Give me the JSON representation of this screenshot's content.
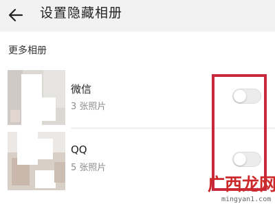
{
  "header": {
    "back_icon": "arrow-left-icon",
    "title": "设置隐藏相册"
  },
  "section": {
    "title": "更多相册"
  },
  "albums": [
    {
      "name": "微信",
      "count": "3 张照片",
      "hidden": false
    },
    {
      "name": "QQ",
      "count": "5 张照片",
      "hidden": false
    }
  ],
  "colors": {
    "header_bg": "#f2f2f2",
    "switch_off": "#ececec",
    "highlight": "#c8283c",
    "watermark": "#cc2a2a"
  },
  "watermark": {
    "logo_text": "广西龙网",
    "url": "mingyan1.com"
  }
}
